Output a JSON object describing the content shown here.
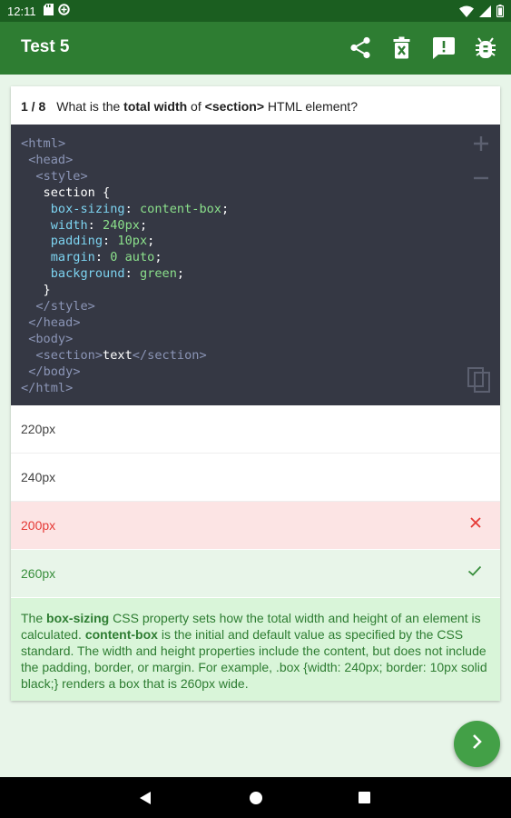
{
  "status_bar": {
    "time": "12:11",
    "icons": [
      "sd-card-icon",
      "data-saver-icon",
      "wifi-icon",
      "signal-icon",
      "battery-icon"
    ]
  },
  "app_bar": {
    "title": "Test 5",
    "actions": [
      "share-icon",
      "delete-icon",
      "feedback-icon",
      "bug-report-icon"
    ]
  },
  "question": {
    "counter": "1 / 8",
    "text_1": "What is the ",
    "bold_1": "total width",
    "text_2": " of ",
    "bold_2": "<section>",
    "text_3": " HTML element?"
  },
  "code": {
    "lines": [
      [
        "",
        "<",
        "html",
        ">"
      ],
      [
        " ",
        "<",
        "head",
        ">"
      ],
      [
        "  ",
        "<",
        "style",
        ">"
      ],
      "   section {",
      [
        "    ",
        "box-sizing",
        ": ",
        "content-box",
        ";"
      ],
      [
        "    ",
        "width",
        ": ",
        "240px",
        ";"
      ],
      [
        "    ",
        "padding",
        ": ",
        "10px",
        ";"
      ],
      [
        "    ",
        "margin",
        ": ",
        "0 auto",
        ";"
      ],
      [
        "    ",
        "background",
        ": ",
        "green",
        ";"
      ],
      "   }",
      [
        "  ",
        "</",
        "style",
        ">"
      ],
      [
        " ",
        "</",
        "head",
        ">"
      ],
      [
        " ",
        "<",
        "body",
        ">"
      ],
      "SECTION_LINE",
      [
        " ",
        "</",
        "body",
        ">"
      ],
      [
        "",
        "</",
        "html",
        ">"
      ]
    ],
    "section_line": {
      "indent": "  ",
      "open_lt": "<",
      "open_tag": "section",
      "open_gt": ">",
      "content": "text",
      "close_lt": "</",
      "close_tag": "section",
      "close_gt": ">"
    }
  },
  "options": [
    {
      "label": "220px",
      "state": "normal"
    },
    {
      "label": "240px",
      "state": "normal"
    },
    {
      "label": "200px",
      "state": "wrong"
    },
    {
      "label": "260px",
      "state": "correct"
    }
  ],
  "explanation": {
    "t1": "The ",
    "b1": "box-sizing",
    "t2": " CSS property sets how the total width and height of an element is calculated. ",
    "b2": "content-box",
    "t3": " is the initial and default value as specified by the CSS standard. The width and height properties include the content, but does not include the padding, border, or margin. For example, .box {width: 240px; border: 10px solid black;} renders a box that is 260px wide."
  },
  "colors": {
    "app_bar": "#2e7d32",
    "status_bar": "#1b5e20",
    "code_bg": "#353844",
    "wrong": "#e53935",
    "correct": "#388e3c",
    "fab": "#43a047"
  }
}
